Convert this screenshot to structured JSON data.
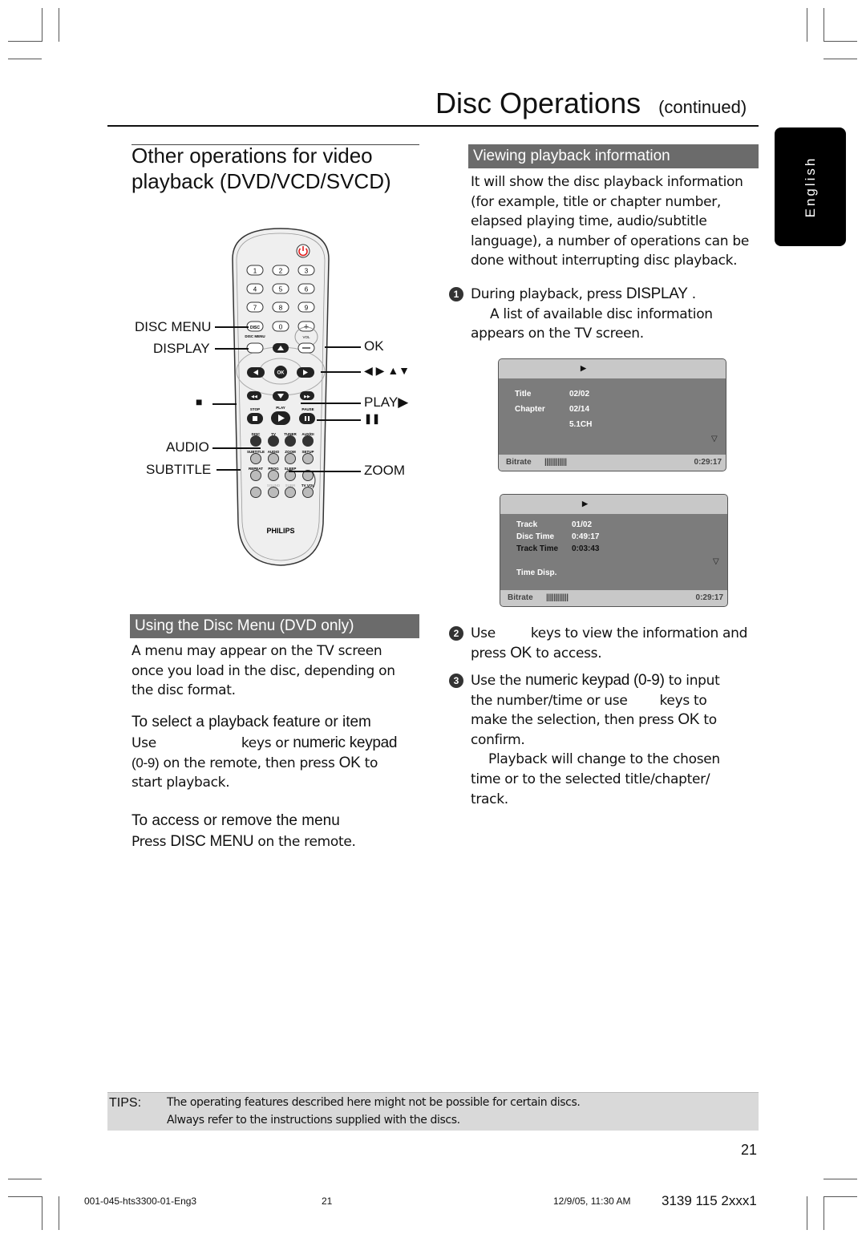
{
  "header": {
    "title": "Disc Operations",
    "continued": "(continued)"
  },
  "language_tab": "English",
  "left": {
    "section_title_line1": "Other operations for video",
    "section_title_line2": "playback (DVD/VCD/SVCD)",
    "remote": {
      "brand": "PHILIPS",
      "keypad": [
        "1",
        "2",
        "3",
        "4",
        "5",
        "6",
        "7",
        "8",
        "9"
      ],
      "key_0": "0",
      "small_labels": {
        "disc_menu": "DISC MENU",
        "vol": "VOL",
        "stop": "STOP",
        "play": "PLAY",
        "pause": "PAUSE",
        "disc": "DISC",
        "tv": "TV",
        "tuner": "TUNER",
        "aux": "AUX/DI",
        "subtitle": "SUBTITLE",
        "audio": "AUDIO",
        "zoom": "ZOOM",
        "setup": "SETUP",
        "repeat": "REPEAT",
        "prog": "PROG",
        "sleep": "SLEEP",
        "sound": "SOUND",
        "surr": "SURR",
        "tv_vol": "TV VOL"
      },
      "callouts": {
        "disc_menu": "DISC MENU",
        "display": "DISPLAY",
        "stop": "■",
        "audio": "AUDIO",
        "subtitle": "SUBTITLE",
        "ok": "OK",
        "arrows": "◀ ▶ ▲▼",
        "play": "PLAY▶",
        "pause": "❚❚",
        "zoom": "ZOOM"
      }
    },
    "disc_menu_bar": "Using the Disc Menu (DVD only)",
    "disc_menu_text": [
      "A menu may appear on the TV screen",
      "once you load in the disc, depending on",
      "the disc format."
    ],
    "select_heading": "To select a playback feature or item",
    "select_text": {
      "use": "Use",
      "keys_or": "keys or",
      "numeric_keypad": "numeric keypad",
      "line2_a": "(0-9)",
      "line2_b": "on the remote, then press",
      "ok": "OK",
      "to": "to",
      "line3": "start playback."
    },
    "access_heading": "To access or remove the menu",
    "access_text": {
      "press": "Press",
      "disc_menu": "DISC MENU",
      "rest": "on the remote."
    }
  },
  "right": {
    "bar": "Viewing playback information",
    "intro": [
      "It will show the disc playback information",
      "(for example, title or chapter number,",
      "elapsed playing time, audio/subtitle",
      "language), a number of operations can be",
      "done without interrupting disc playback."
    ],
    "step1": {
      "num": "1",
      "a": "During playback, press",
      "key": "DISPLAY",
      "end": ".",
      "line2": "A list of available disc information",
      "line3": "appears on the TV screen."
    },
    "osd1": {
      "rows": [
        {
          "label": "Title",
          "value": "02/02"
        },
        {
          "label": "Chapter",
          "value": "02/14"
        },
        {
          "label": "",
          "value": "5.1CH"
        }
      ],
      "bitrate_label": "Bitrate",
      "bitrate_bars": "||||||||||||",
      "time": "0:29:17"
    },
    "osd2": {
      "rows": [
        {
          "label": "Track",
          "value": "01/02"
        },
        {
          "label": "Disc Time",
          "value": "0:49:17"
        },
        {
          "label": "Track Time",
          "value": "0:03:43"
        }
      ],
      "extra": "Time Disp.",
      "bitrate_label": "Bitrate",
      "bitrate_bars": "||||||||||||",
      "time": "0:29:17"
    },
    "step2": {
      "num": "2",
      "a": "Use",
      "b": "keys to view the information and",
      "line2_a": "press",
      "ok": "OK",
      "line2_b": "to access."
    },
    "step3": {
      "num": "3",
      "a": "Use the",
      "keypad": "numeric keypad (0-9)",
      "b": "to input",
      "line2_a": "the number/time or use",
      "line2_b": "keys to",
      "line3_a": "make the selection, then press",
      "ok": "OK",
      "line3_b": "to",
      "line4": "confirm.",
      "line5": "Playback will change to the chosen",
      "line6": "time or to the selected title/chapter/",
      "line7": "track."
    }
  },
  "tips": {
    "label": "TIPS:",
    "line1": "The operating features described here might not be possible for certain discs.",
    "line2": "Always refer to the instructions supplied with the discs."
  },
  "page_number": "21",
  "footer": {
    "file": "001-045-hts3300-01-Eng3",
    "page": "21",
    "date": "12/9/05, 11:30 AM",
    "code": "3139 115 2xxx1"
  }
}
